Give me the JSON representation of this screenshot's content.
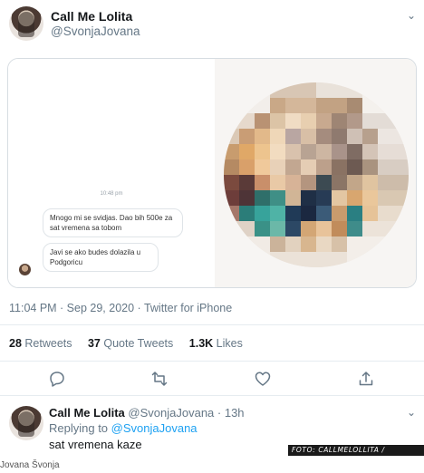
{
  "tweet": {
    "author_name": "Call Me Lolita",
    "author_handle": "@SvonjaJovana",
    "meta": "11:04 PM · Sep 29, 2020 · Twitter for iPhone",
    "stats": {
      "retweets_count": "28",
      "retweets_label": "Retweets",
      "quotes_count": "37",
      "quotes_label": "Quote Tweets",
      "likes_count": "1.3K",
      "likes_label": "Likes"
    },
    "actions": [
      "reply-icon",
      "retweet-icon",
      "like-icon",
      "share-icon"
    ]
  },
  "media": {
    "chat_time": "10:48 pm",
    "message_1": "Mnogo mi se svidjas. Dao bih 500e za sat vremena sa tobom",
    "message_2": "Javi se ako budes dolazila u Podgoricu"
  },
  "reply": {
    "author_name": "Call Me Lolita",
    "author_handle": "@SvonjaJovana · 13h",
    "replying_prefix": "Replying to",
    "replying_to": "@SvonjaJovana",
    "text": "sat vremena kaze"
  },
  "photo_credit": "FOTO: CALLMELOLLITA / TWITTER",
  "caption": "Jovana Švonja",
  "colors": {
    "link": "#1da1f2",
    "muted": "#657786",
    "text": "#14171a"
  }
}
